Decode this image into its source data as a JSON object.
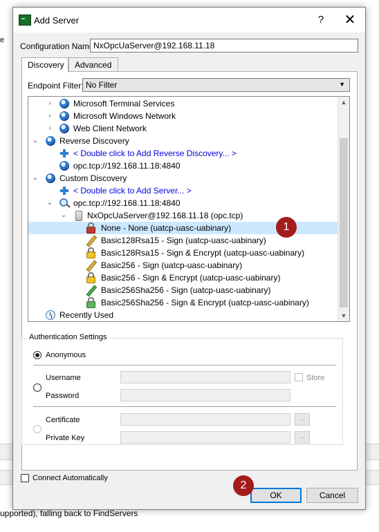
{
  "background": {
    "left_fragment": "e",
    "status_fragment": "upported), falling back to FindServers"
  },
  "dialog": {
    "title": "Add Server",
    "help_label": "?",
    "close_label": "✕"
  },
  "config": {
    "label": "Configuration Name",
    "value": "NxOpcUaServer@192.168.11.18"
  },
  "tabs": [
    {
      "label": "Discovery",
      "active": true
    },
    {
      "label": "Advanced",
      "active": false
    }
  ],
  "endpoint_filter": {
    "label": "Endpoint Filter:",
    "value": "No Filter"
  },
  "tree": {
    "items": [
      {
        "label": "Microsoft Terminal Services",
        "icon": "globe-icon",
        "expander": "›"
      },
      {
        "label": "Microsoft Windows Network",
        "icon": "globe-icon",
        "expander": "›"
      },
      {
        "label": "Web Client Network",
        "icon": "globe-icon",
        "expander": "›"
      },
      {
        "label": "Reverse Discovery",
        "icon": "globe-icon",
        "expander": "⌄"
      },
      {
        "label": "< Double click to Add Reverse Discovery... >",
        "icon": "add-icon"
      },
      {
        "label": "opc.tcp://192.168.11.18:4840",
        "icon": "globe-icon"
      },
      {
        "label": "Custom Discovery",
        "icon": "globe-icon",
        "expander": "⌄"
      },
      {
        "label": "< Double click to Add Server... >",
        "icon": "add-icon"
      },
      {
        "label": "opc.tcp://192.168.11.18:4840",
        "icon": "magnifier-icon",
        "expander": "⌄"
      },
      {
        "label": "NxOpcUaServer@192.168.11.18 (opc.tcp)",
        "icon": "server-icon",
        "expander": "⌄"
      },
      {
        "label": "None - None (uatcp-uasc-uabinary)",
        "icon": "unsecure-lock-icon",
        "selected": true
      },
      {
        "label": "Basic128Rsa15 - Sign (uatcp-uasc-uabinary)",
        "icon": "sign-pencil-icon"
      },
      {
        "label": "Basic128Rsa15 - Sign & Encrypt (uatcp-uasc-uabinary)",
        "icon": "lock-icon"
      },
      {
        "label": "Basic256 - Sign (uatcp-uasc-uabinary)",
        "icon": "sign-pencil-icon"
      },
      {
        "label": "Basic256 - Sign & Encrypt (uatcp-uasc-uabinary)",
        "icon": "lock-icon"
      },
      {
        "label": "Basic256Sha256 - Sign (uatcp-uasc-uabinary)",
        "icon": "green-pencil-icon"
      },
      {
        "label": "Basic256Sha256 - Sign & Encrypt (uatcp-uasc-uabinary)",
        "icon": "green-lock-icon"
      },
      {
        "label": "Recently Used",
        "icon": "clock-icon"
      }
    ]
  },
  "auth": {
    "legend": "Authentication Settings",
    "anonymous": "Anonymous",
    "username": "Username",
    "password": "Password",
    "store": "Store",
    "certificate": "Certificate",
    "private_key": "Private Key",
    "browse": "...",
    "selected_mode": "Anonymous"
  },
  "footer": {
    "connect_auto": "Connect Automatically",
    "ok": "OK",
    "cancel": "Cancel"
  },
  "annotations": {
    "badge1": "1",
    "badge2": "2",
    "badge_color": "#a31c1c"
  },
  "colors": {
    "selection": "#cce8ff",
    "link": "#0000e0",
    "default_button_border": "#0078d7"
  }
}
